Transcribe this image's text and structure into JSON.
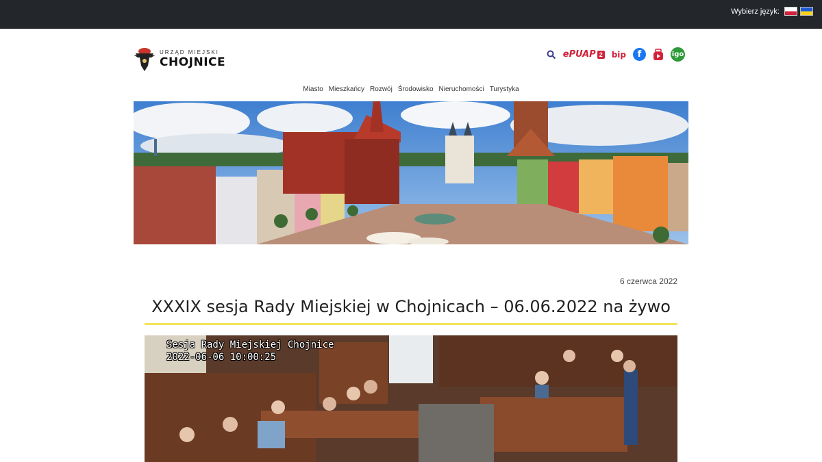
{
  "top_bar": {
    "language_label": "Wybierz język:",
    "languages": [
      "pl-flag",
      "ua-flag"
    ],
    "background": "#23272b"
  },
  "header": {
    "logo_small": "URZĄD MIEJSKI",
    "logo_big": "CHOJNICE",
    "icons": [
      "search-icon",
      "epuap-icon",
      "bip-icon",
      "facebook-icon",
      "youtube-icon",
      "igo-icon"
    ],
    "epuap_text": "ePUAP",
    "epuap_num": "2",
    "bip_text": "bip",
    "fb_letter": "f",
    "igo_text": "igo"
  },
  "nav": {
    "items": [
      "Miasto",
      "Mieszkańcy",
      "Rozwój",
      "Środowisko",
      "Nieruchomości",
      "Turystyka"
    ]
  },
  "article": {
    "date": "6 czerwca 2022",
    "title": "XXXIX sesja Rady Miejskiej w Chojnicach – 06.06.2022 na żywo",
    "video_caption_line1": "Sesja Rady Miejskiej Chojnice",
    "video_caption_line2": "2022-06-06 10:00:25"
  },
  "colors": {
    "accent_red": "#d2233c",
    "underline_yellow": "#f5e35b",
    "facebook_blue": "#1877f2",
    "igo_green": "#2e9a3a"
  }
}
